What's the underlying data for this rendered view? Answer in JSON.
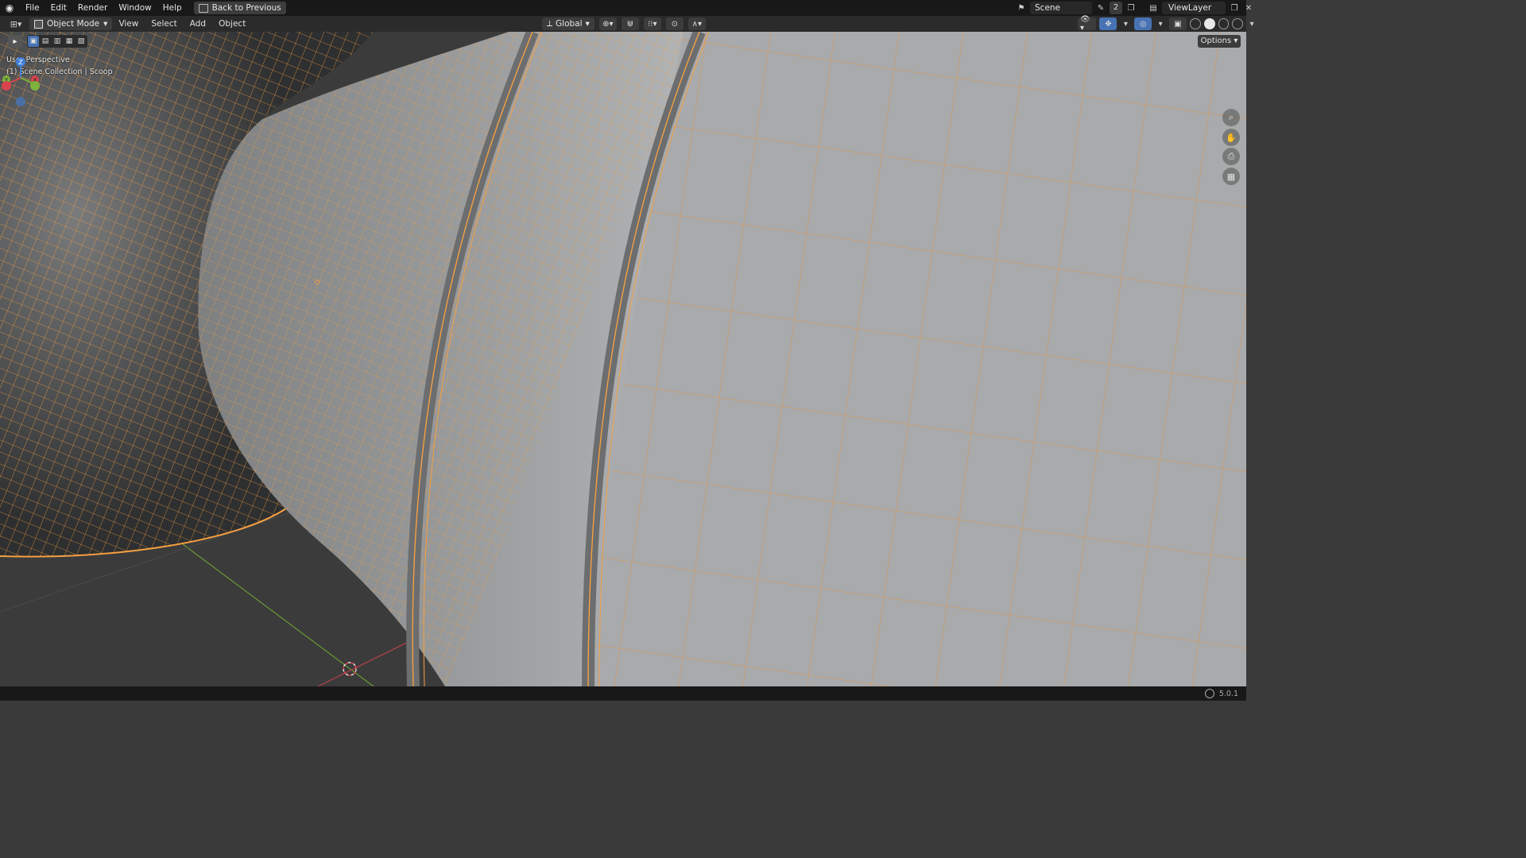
{
  "topbar": {
    "menus": [
      "File",
      "Edit",
      "Render",
      "Window",
      "Help"
    ],
    "back_button": "Back to Previous",
    "scene_name": "Scene",
    "scene_users": "2",
    "view_layer": "ViewLayer"
  },
  "header": {
    "mode": "Object Mode",
    "menus": [
      "View",
      "Select",
      "Add",
      "Object"
    ],
    "orientation": "Global",
    "options": "Options"
  },
  "viewport": {
    "perspective_label": "User Perspective",
    "collection_label": "(1) Scene Collection | Scoop",
    "gizmo_axes": [
      "Z",
      "Y",
      "X"
    ],
    "wire_color": "#f5a040",
    "mesh_color": "#b4b6b8"
  },
  "status": {
    "version": "5.0.1"
  },
  "colors": {
    "accent": "#4772b3",
    "axis_x": "#d8434e",
    "axis_y": "#7db33b",
    "axis_z": "#3f7fd9"
  }
}
